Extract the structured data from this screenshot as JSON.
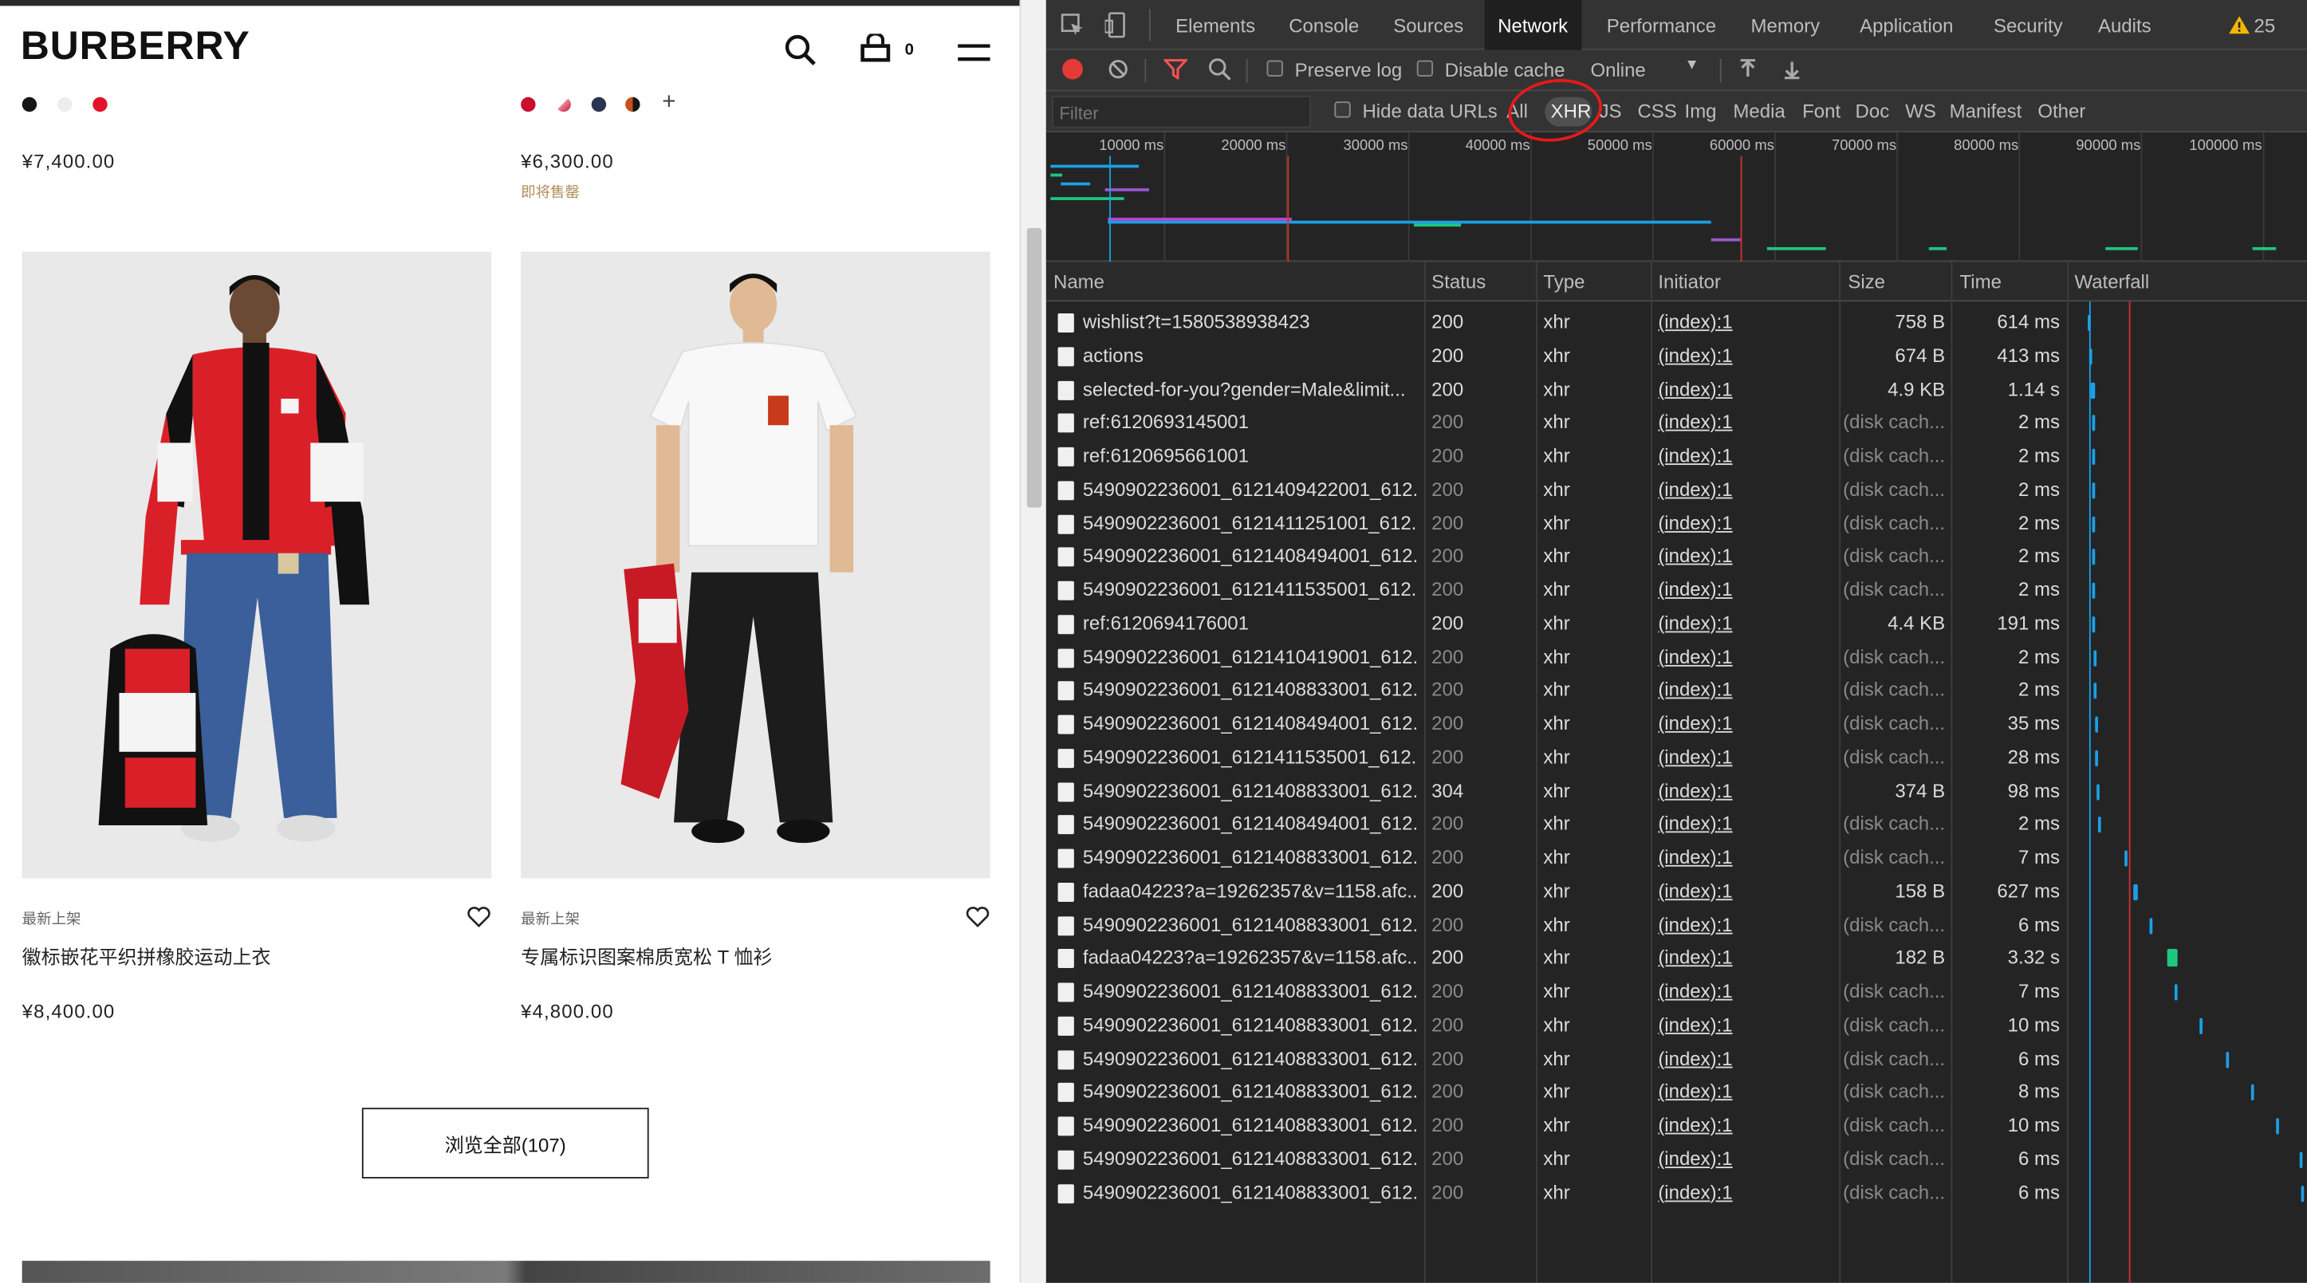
{
  "website": {
    "logo": "BURBERRY",
    "cart_count": "0",
    "top_products": [
      {
        "price": "¥7,400.00",
        "swatches": [
          "#161616",
          "#ededed",
          "#e0142a"
        ]
      },
      {
        "price": "¥6,300.00",
        "status": "即将售罄",
        "swatches": [
          "#c8102e",
          "#e88a9a",
          "#2a3350",
          "#c8501a"
        ]
      }
    ],
    "products": [
      {
        "tag": "最新上架",
        "name": "徽标嵌花平织拼橡胶运动上衣",
        "price": "¥8,400.00"
      },
      {
        "tag": "最新上架",
        "name": "专属标识图案棉质宽松 T 恤衫",
        "price": "¥4,800.00"
      }
    ],
    "view_all": "浏览全部(107)",
    "more_swatch_symbol": "+"
  },
  "devtools": {
    "tabs": [
      "Elements",
      "Console",
      "Sources",
      "Network",
      "Performance",
      "Memory",
      "Application",
      "Security",
      "Audits"
    ],
    "active_tab": "Network",
    "warnings_count": "25",
    "toolbar": {
      "preserve_log": "Preserve log",
      "disable_cache": "Disable cache",
      "throttle": "Online"
    },
    "filter": {
      "placeholder": "Filter",
      "hide_data_urls": "Hide data URLs",
      "types": [
        "All",
        "XHR",
        "JS",
        "CSS",
        "Img",
        "Media",
        "Font",
        "Doc",
        "WS",
        "Manifest",
        "Other"
      ],
      "active_type": "XHR"
    },
    "timeline_ticks": [
      "10000 ms",
      "20000 ms",
      "30000 ms",
      "40000 ms",
      "50000 ms",
      "60000 ms",
      "70000 ms",
      "80000 ms",
      "90000 ms",
      "100000 ms"
    ],
    "columns": [
      "Name",
      "Status",
      "Type",
      "Initiator",
      "Size",
      "Time",
      "Waterfall"
    ],
    "requests": [
      {
        "name": "wishlist?t=1580538938423",
        "status": "200",
        "type": "xhr",
        "initiator": "(index):1",
        "size": "758 B",
        "time": "614 ms",
        "cached": false
      },
      {
        "name": "actions",
        "status": "200",
        "type": "xhr",
        "initiator": "(index):1",
        "size": "674 B",
        "time": "413 ms",
        "cached": false
      },
      {
        "name": "selected-for-you?gender=Male&limit...",
        "status": "200",
        "type": "xhr",
        "initiator": "(index):1",
        "size": "4.9 KB",
        "time": "1.14 s",
        "cached": false
      },
      {
        "name": "ref:6120693145001",
        "status": "200",
        "type": "xhr",
        "initiator": "(index):1",
        "size": "(disk cach...",
        "time": "2 ms",
        "cached": true
      },
      {
        "name": "ref:6120695661001",
        "status": "200",
        "type": "xhr",
        "initiator": "(index):1",
        "size": "(disk cach...",
        "time": "2 ms",
        "cached": true
      },
      {
        "name": "5490902236001_6121409422001_612...",
        "status": "200",
        "type": "xhr",
        "initiator": "(index):1",
        "size": "(disk cach...",
        "time": "2 ms",
        "cached": true
      },
      {
        "name": "5490902236001_6121411251001_612...",
        "status": "200",
        "type": "xhr",
        "initiator": "(index):1",
        "size": "(disk cach...",
        "time": "2 ms",
        "cached": true
      },
      {
        "name": "5490902236001_6121408494001_612...",
        "status": "200",
        "type": "xhr",
        "initiator": "(index):1",
        "size": "(disk cach...",
        "time": "2 ms",
        "cached": true
      },
      {
        "name": "5490902236001_6121411535001_612...",
        "status": "200",
        "type": "xhr",
        "initiator": "(index):1",
        "size": "(disk cach...",
        "time": "2 ms",
        "cached": true
      },
      {
        "name": "ref:6120694176001",
        "status": "200",
        "type": "xhr",
        "initiator": "(index):1",
        "size": "4.4 KB",
        "time": "191 ms",
        "cached": false
      },
      {
        "name": "5490902236001_6121410419001_612...",
        "status": "200",
        "type": "xhr",
        "initiator": "(index):1",
        "size": "(disk cach...",
        "time": "2 ms",
        "cached": true
      },
      {
        "name": "5490902236001_6121408833001_612...",
        "status": "200",
        "type": "xhr",
        "initiator": "(index):1",
        "size": "(disk cach...",
        "time": "2 ms",
        "cached": true
      },
      {
        "name": "5490902236001_6121408494001_612...",
        "status": "200",
        "type": "xhr",
        "initiator": "(index):1",
        "size": "(disk cach...",
        "time": "35 ms",
        "cached": true
      },
      {
        "name": "5490902236001_6121411535001_612...",
        "status": "200",
        "type": "xhr",
        "initiator": "(index):1",
        "size": "(disk cach...",
        "time": "28 ms",
        "cached": true
      },
      {
        "name": "5490902236001_6121408833001_612...",
        "status": "304",
        "type": "xhr",
        "initiator": "(index):1",
        "size": "374 B",
        "time": "98 ms",
        "cached": false
      },
      {
        "name": "5490902236001_6121408494001_612...",
        "status": "200",
        "type": "xhr",
        "initiator": "(index):1",
        "size": "(disk cach...",
        "time": "2 ms",
        "cached": true
      },
      {
        "name": "5490902236001_6121408833001_612...",
        "status": "200",
        "type": "xhr",
        "initiator": "(index):1",
        "size": "(disk cach...",
        "time": "7 ms",
        "cached": true
      },
      {
        "name": "fadaa04223?a=19262357&v=1158.afc...",
        "status": "200",
        "type": "xhr",
        "initiator": "(index):1",
        "size": "158 B",
        "time": "627 ms",
        "cached": false
      },
      {
        "name": "5490902236001_6121408833001_612...",
        "status": "200",
        "type": "xhr",
        "initiator": "(index):1",
        "size": "(disk cach...",
        "time": "6 ms",
        "cached": true
      },
      {
        "name": "fadaa04223?a=19262357&v=1158.afc...",
        "status": "200",
        "type": "xhr",
        "initiator": "(index):1",
        "size": "182 B",
        "time": "3.32 s",
        "cached": false
      },
      {
        "name": "5490902236001_6121408833001_612...",
        "status": "200",
        "type": "xhr",
        "initiator": "(index):1",
        "size": "(disk cach...",
        "time": "7 ms",
        "cached": true
      },
      {
        "name": "5490902236001_6121408833001_612...",
        "status": "200",
        "type": "xhr",
        "initiator": "(index):1",
        "size": "(disk cach...",
        "time": "10 ms",
        "cached": true
      },
      {
        "name": "5490902236001_6121408833001_612...",
        "status": "200",
        "type": "xhr",
        "initiator": "(index):1",
        "size": "(disk cach...",
        "time": "6 ms",
        "cached": true
      },
      {
        "name": "5490902236001_6121408833001_612...",
        "status": "200",
        "type": "xhr",
        "initiator": "(index):1",
        "size": "(disk cach...",
        "time": "8 ms",
        "cached": true
      },
      {
        "name": "5490902236001_6121408833001_612...",
        "status": "200",
        "type": "xhr",
        "initiator": "(index):1",
        "size": "(disk cach...",
        "time": "10 ms",
        "cached": true
      },
      {
        "name": "5490902236001_6121408833001_612...",
        "status": "200",
        "type": "xhr",
        "initiator": "(index):1",
        "size": "(disk cach...",
        "time": "6 ms",
        "cached": true
      },
      {
        "name": "5490902236001_6121408833001_612...",
        "status": "200",
        "type": "xhr",
        "initiator": "(index):1",
        "size": "(disk cach...",
        "time": "6 ms",
        "cached": true
      }
    ],
    "colors": {
      "record": "#e53935",
      "filter_active": "#ff5252",
      "waterfall_blue": "#1aa0e8",
      "waterfall_green": "#1ec780",
      "accent_red": "#d03030"
    }
  }
}
